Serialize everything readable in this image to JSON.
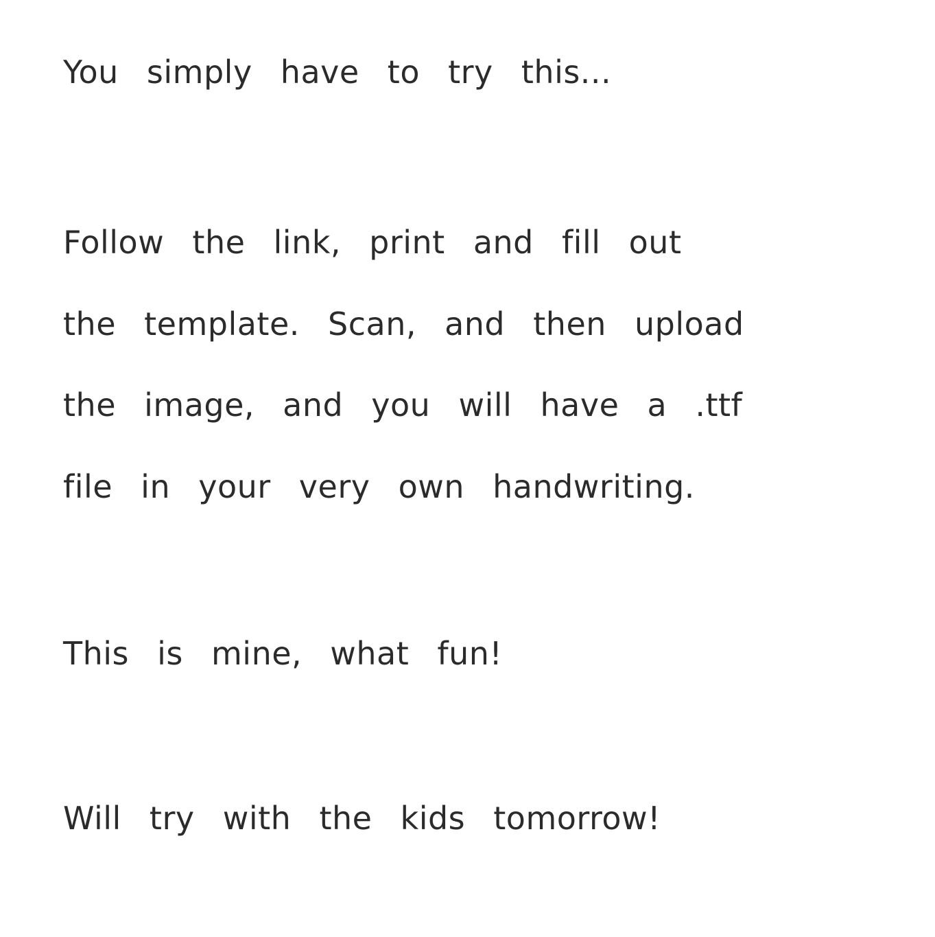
{
  "note": {
    "lines": [
      "You simply have to try this...",
      "Follow the link, print and fill out",
      "the template.  Scan, and then upload",
      "the image, and you will have a .ttf",
      "file in your very own handwriting.",
      "This is mine, what fun!",
      "Will try with the kids tomorrow!"
    ],
    "text_color": "#2b2b2b",
    "background_color": "#ffffff"
  }
}
